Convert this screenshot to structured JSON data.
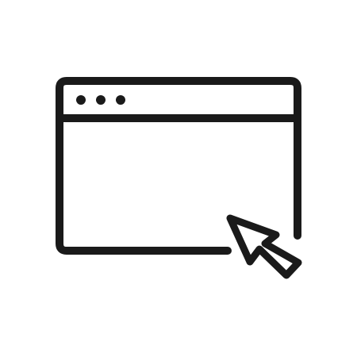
{
  "icon": {
    "name": "browser-window-with-cursor-icon",
    "stroke_color": "#1a1a1a",
    "background_color": "#ffffff",
    "parts": [
      "browser-window-icon",
      "window-control-dots-icon",
      "mouse-pointer-cursor-icon"
    ]
  }
}
